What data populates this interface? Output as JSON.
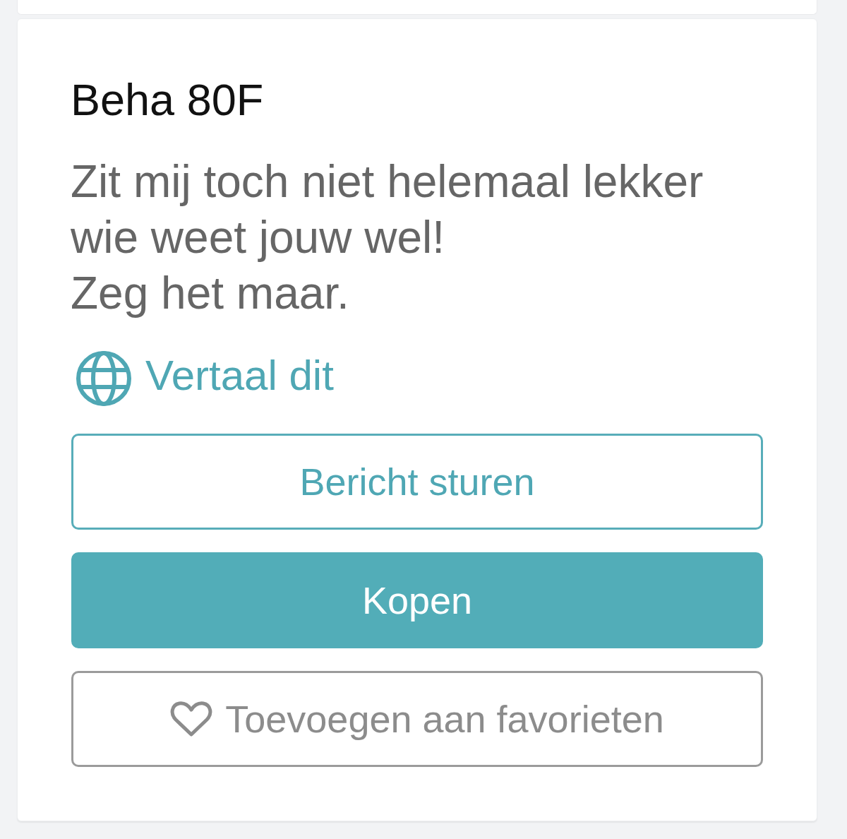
{
  "listing": {
    "title": "Beha 80F",
    "description": "Zit mij toch niet helemaal lekker\nwie weet jouw wel!\nZeg het maar.",
    "translate_link": "Vertaal dit"
  },
  "buttons": [
    {
      "kind": "outline",
      "label": "Bericht sturen"
    },
    {
      "kind": "primary",
      "label": "Kopen"
    },
    {
      "kind": "favorite",
      "label": "Toevoegen aan favorieten"
    }
  ]
}
